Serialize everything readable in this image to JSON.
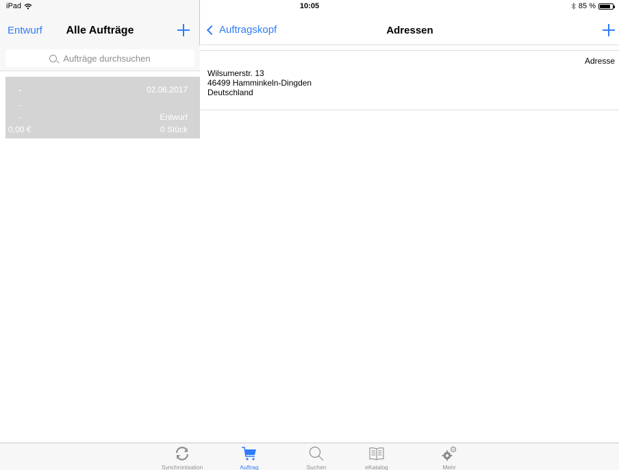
{
  "status_bar": {
    "device": "iPad",
    "time": "10:05",
    "battery_text": "85 %",
    "battery_level": 0.85
  },
  "master": {
    "left_button": "Entwurf",
    "title": "Alle Aufträge",
    "search_placeholder": "Aufträge durchsuchen",
    "orders": [
      {
        "name": "-",
        "date": "02.06.2017",
        "line2": "-",
        "line3": "-",
        "status": "Entwurf",
        "amount": "0,00 €",
        "quantity": "0 Stück"
      }
    ]
  },
  "detail": {
    "back_label": "Auftragskopf",
    "title": "Adressen",
    "address_section_label": "Adresse",
    "address_lines": [
      "Wilsumerstr. 13",
      "46499 Hamminkeln-Dingden",
      "Deutschland"
    ]
  },
  "tab_bar": {
    "tabs": [
      {
        "label": "Synchronisation",
        "icon": "sync-icon",
        "active": false
      },
      {
        "label": "Auftrag",
        "icon": "cart-icon",
        "active": true
      },
      {
        "label": "Suchen",
        "icon": "search-icon",
        "active": false
      },
      {
        "label": "eKatalog",
        "icon": "book-icon",
        "active": false
      },
      {
        "label": "Mehr",
        "icon": "gears-icon",
        "active": false
      }
    ]
  },
  "colors": {
    "accent": "#2f7cf6",
    "inactive_tab": "#8e8e93",
    "selected_row": "#d4d4d4"
  }
}
